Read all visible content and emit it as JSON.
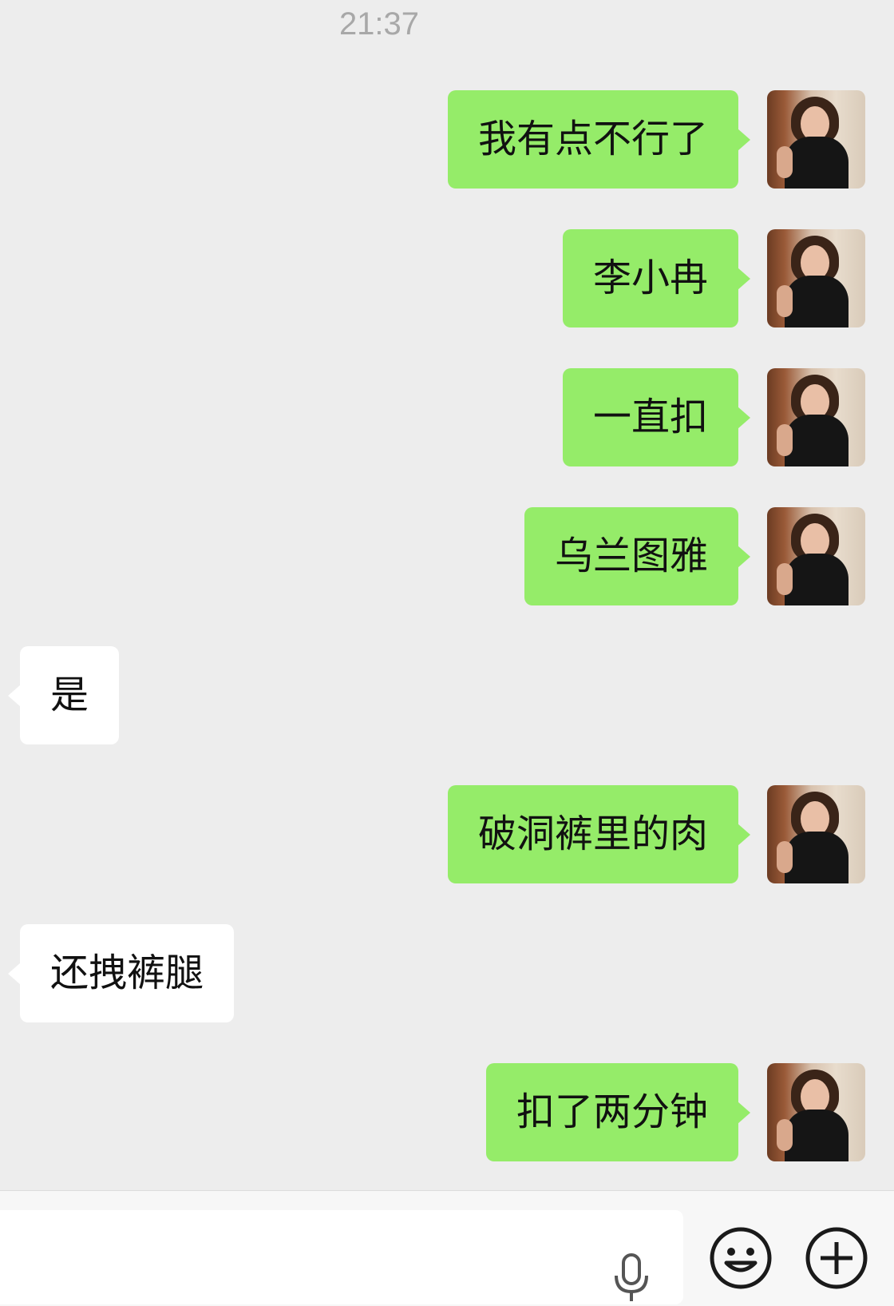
{
  "timestamp": "21:37",
  "messages": [
    {
      "text": "我有点不行了",
      "direction": "out"
    },
    {
      "text": "李小冉",
      "direction": "out"
    },
    {
      "text": "一直扣",
      "direction": "out"
    },
    {
      "text": "乌兰图雅",
      "direction": "out"
    },
    {
      "text": "是",
      "direction": "in"
    },
    {
      "text": "破洞裤里的肉",
      "direction": "out"
    },
    {
      "text": "还拽裤腿",
      "direction": "in"
    },
    {
      "text": "扣了两分钟",
      "direction": "out"
    }
  ],
  "colors": {
    "background": "#ededed",
    "outgoing_bubble": "#95ec69",
    "incoming_bubble": "#ffffff",
    "timestamp_text": "#a8a8a8"
  },
  "input_bar": {
    "icons": [
      "voice-icon",
      "emoji-icon",
      "plus-icon"
    ]
  }
}
